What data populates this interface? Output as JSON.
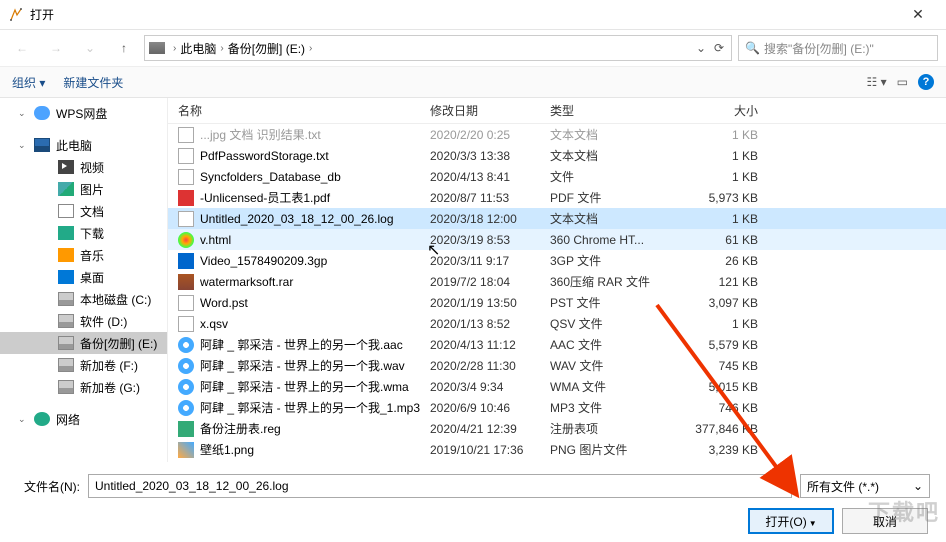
{
  "window": {
    "title": "打开",
    "close": "✕"
  },
  "nav": {
    "back": "←",
    "fwd": "→",
    "up": "↑"
  },
  "breadcrumb": {
    "p1": "此电脑",
    "p2": "备份[勿删] (E:)",
    "refresh": "⟳"
  },
  "search": {
    "placeholder": "搜索\"备份[勿删] (E:)\""
  },
  "toolbar": {
    "organize": "组织",
    "newfolder": "新建文件夹"
  },
  "sidebar": [
    {
      "label": "WPS网盘",
      "icon": "i-cloud",
      "child": false
    },
    {
      "label": "此电脑",
      "icon": "i-pc",
      "child": false
    },
    {
      "label": "视频",
      "icon": "i-video",
      "child": true
    },
    {
      "label": "图片",
      "icon": "i-pic",
      "child": true
    },
    {
      "label": "文档",
      "icon": "i-doc",
      "child": true
    },
    {
      "label": "下载",
      "icon": "i-down",
      "child": true
    },
    {
      "label": "音乐",
      "icon": "i-music",
      "child": true
    },
    {
      "label": "桌面",
      "icon": "i-desk",
      "child": true
    },
    {
      "label": "本地磁盘 (C:)",
      "icon": "i-disk",
      "child": true
    },
    {
      "label": "软件 (D:)",
      "icon": "i-disk",
      "child": true
    },
    {
      "label": "备份[勿删] (E:)",
      "icon": "i-disk",
      "child": true,
      "selected": true
    },
    {
      "label": "新加卷 (F:)",
      "icon": "i-disk",
      "child": true
    },
    {
      "label": "新加卷 (G:)",
      "icon": "i-disk",
      "child": true
    },
    {
      "label": "网络",
      "icon": "i-net",
      "child": false
    }
  ],
  "headers": {
    "name": "名称",
    "date": "修改日期",
    "type": "类型",
    "size": "大小"
  },
  "files": [
    {
      "name": "PdfPasswordStorage.txt",
      "date": "2020/3/3 13:38",
      "type": "文本文档",
      "size": "1 KB",
      "icon": "fi-txt"
    },
    {
      "name": "Syncfolders_Database_db",
      "date": "2020/4/13 8:41",
      "type": "文件",
      "size": "1 KB",
      "icon": "fi-db"
    },
    {
      "name": "-Unlicensed-员工表1.pdf",
      "date": "2020/8/7 11:53",
      "type": "PDF 文件",
      "size": "5,973 KB",
      "icon": "fi-pdf"
    },
    {
      "name": "Untitled_2020_03_18_12_00_26.log",
      "date": "2020/3/18 12:00",
      "type": "文本文档",
      "size": "1 KB",
      "icon": "fi-txt",
      "selected": true
    },
    {
      "name": "v.html",
      "date": "2020/3/19 8:53",
      "type": "360 Chrome HT...",
      "size": "61 KB",
      "icon": "fi-html",
      "hover": true
    },
    {
      "name": "Video_1578490209.3gp",
      "date": "2020/3/11 9:17",
      "type": "3GP 文件",
      "size": "26 KB",
      "icon": "fi-3gp"
    },
    {
      "name": "watermarksoft.rar",
      "date": "2019/7/2 18:04",
      "type": "360压缩 RAR 文件",
      "size": "121 KB",
      "icon": "fi-rar"
    },
    {
      "name": "Word.pst",
      "date": "2020/1/19 13:50",
      "type": "PST 文件",
      "size": "3,097 KB",
      "icon": "fi-pst"
    },
    {
      "name": "x.qsv",
      "date": "2020/1/13 8:52",
      "type": "QSV 文件",
      "size": "1 KB",
      "icon": "fi-qsv"
    },
    {
      "name": "阿肆 _ 郭采洁 - 世界上的另一个我.aac",
      "date": "2020/4/13 11:12",
      "type": "AAC 文件",
      "size": "5,579 KB",
      "icon": "fi-aac"
    },
    {
      "name": "阿肆 _ 郭采洁 - 世界上的另一个我.wav",
      "date": "2020/2/28 11:30",
      "type": "WAV 文件",
      "size": "745 KB",
      "icon": "fi-wav"
    },
    {
      "name": "阿肆 _ 郭采洁 - 世界上的另一个我.wma",
      "date": "2020/3/4 9:34",
      "type": "WMA 文件",
      "size": "5,015 KB",
      "icon": "fi-wma"
    },
    {
      "name": "阿肆 _ 郭采洁 - 世界上的另一个我_1.mp3",
      "date": "2020/6/9 10:46",
      "type": "MP3 文件",
      "size": "746 KB",
      "icon": "fi-mp3"
    },
    {
      "name": "备份注册表.reg",
      "date": "2020/4/21 12:39",
      "type": "注册表项",
      "size": "377,846 KB",
      "icon": "fi-reg"
    },
    {
      "name": "壁纸1.png",
      "date": "2019/10/21 17:36",
      "type": "PNG 图片文件",
      "size": "3,239 KB",
      "icon": "fi-png"
    }
  ],
  "bottom": {
    "filename_label": "文件名(N):",
    "filename_value": "Untitled_2020_03_18_12_00_26.log",
    "filter": "所有文件 (*.*)",
    "open": "打开(O)",
    "cancel": "取消"
  },
  "watermark": "下载吧"
}
